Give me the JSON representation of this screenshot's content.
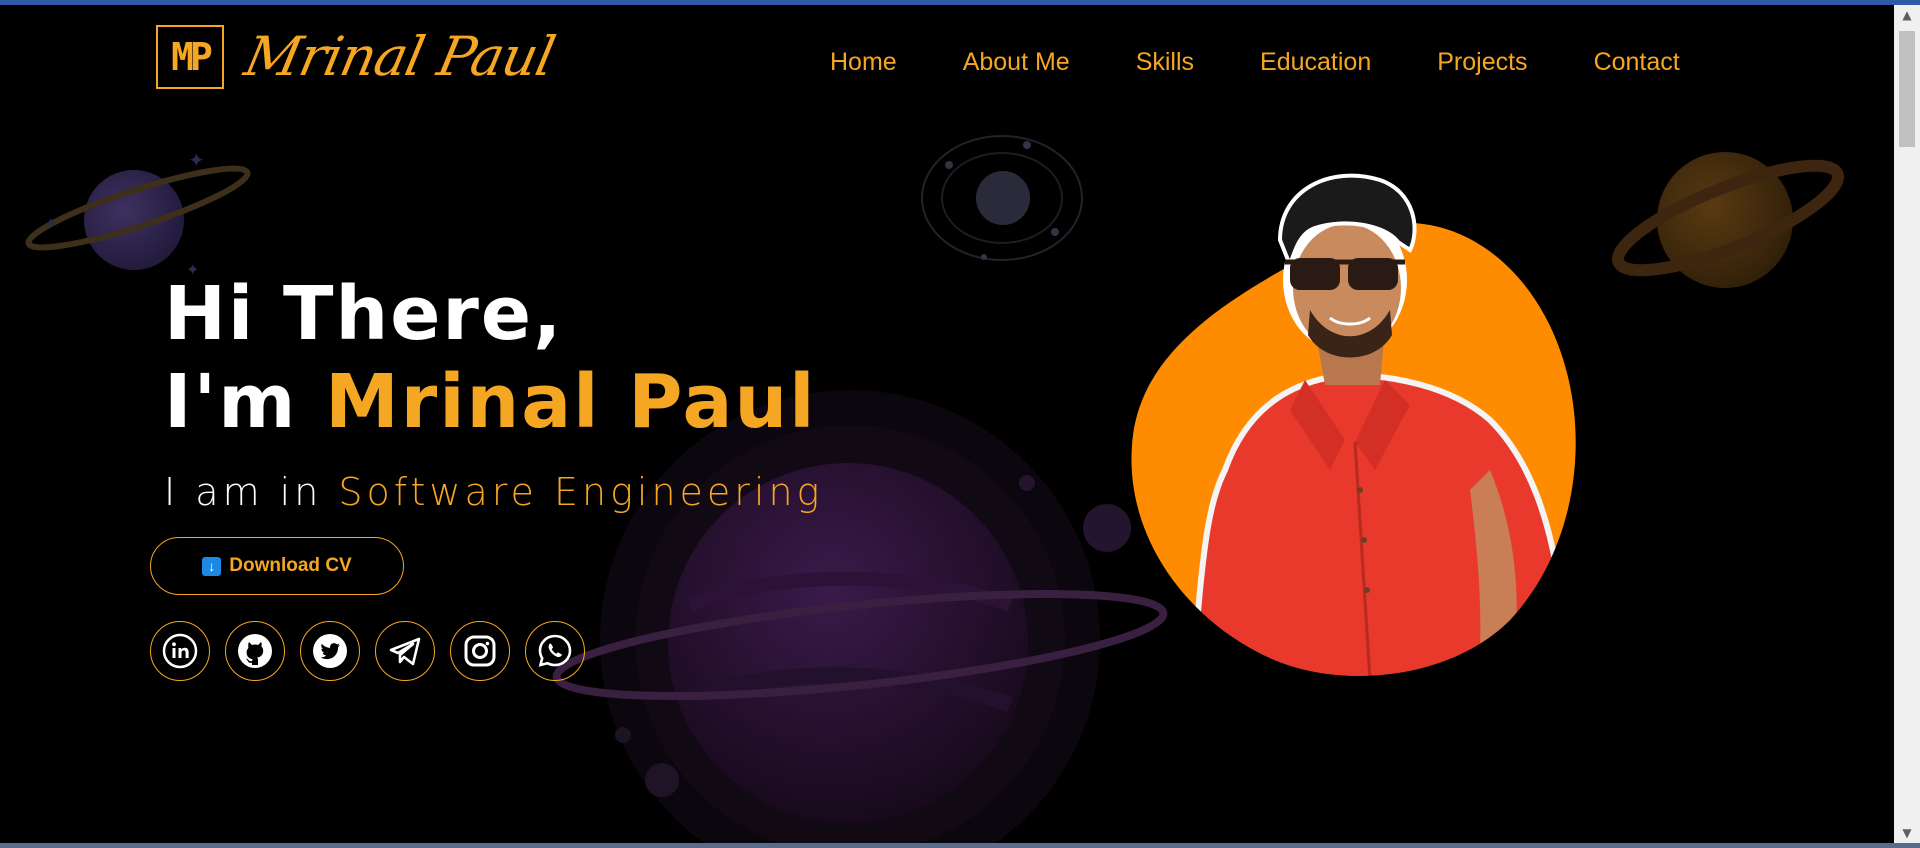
{
  "logo": {
    "monogram": "MP",
    "script": "Mrinal Paul"
  },
  "nav": {
    "items": [
      {
        "label": "Home"
      },
      {
        "label": "About Me"
      },
      {
        "label": "Skills"
      },
      {
        "label": "Education"
      },
      {
        "label": "Projects"
      },
      {
        "label": "Contact"
      }
    ]
  },
  "hero": {
    "greeting": "Hi There,",
    "intro_prefix": "I'm",
    "name": "Mrinal Paul",
    "subtitle_prefix": "I am in",
    "subtitle_role": "Software Engineering",
    "cv_button_label": "Download CV",
    "cv_icon": "download-arrow-icon"
  },
  "socials": [
    {
      "icon": "linkedin-icon"
    },
    {
      "icon": "github-icon"
    },
    {
      "icon": "twitter-icon"
    },
    {
      "icon": "telegram-icon"
    },
    {
      "icon": "instagram-icon"
    },
    {
      "icon": "whatsapp-icon"
    }
  ],
  "colors": {
    "accent": "#f5a623",
    "background": "#000000",
    "blob": "#ff8c00",
    "shirt": "#e8392c"
  }
}
